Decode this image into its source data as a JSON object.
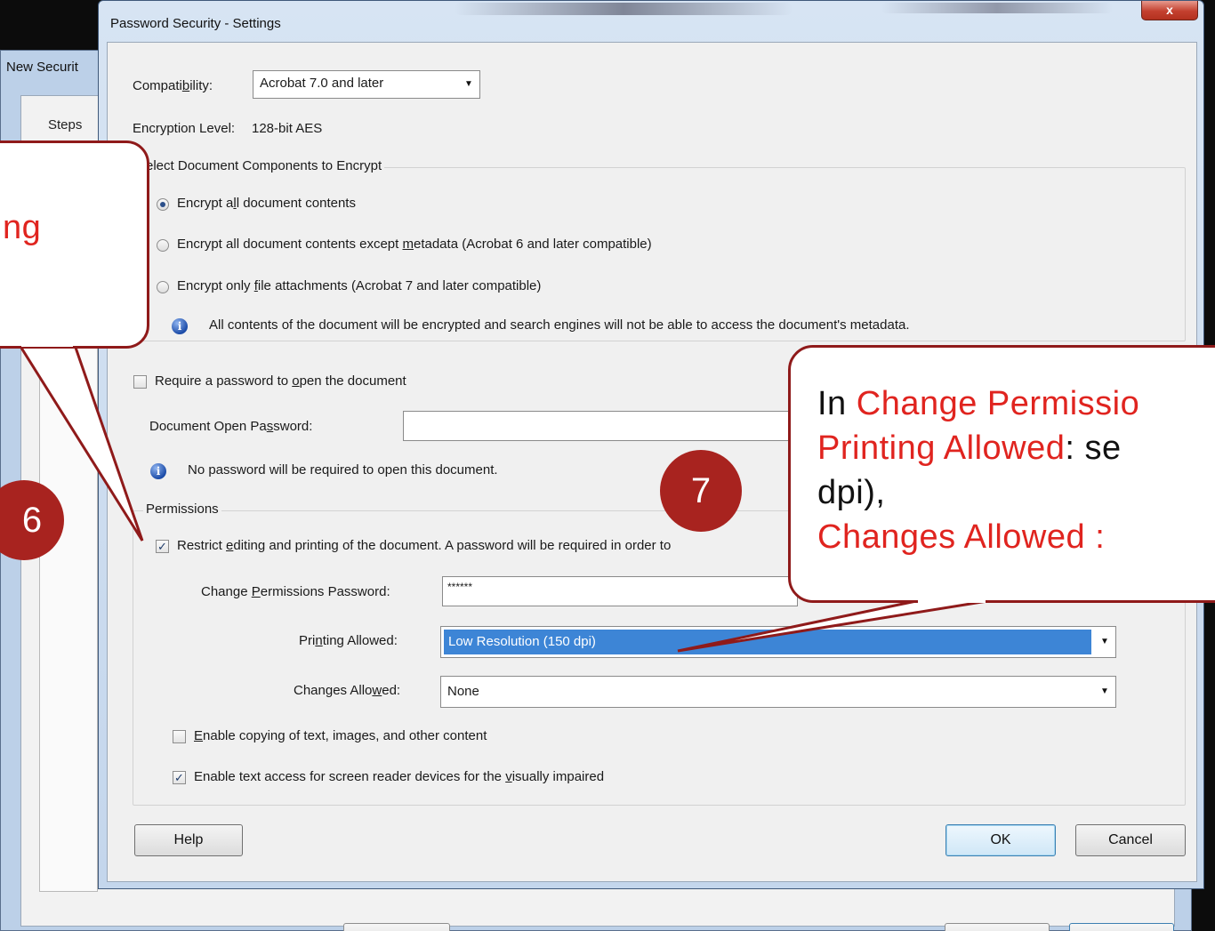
{
  "background_dialog": {
    "title": "New Securit",
    "steps_label": "Steps"
  },
  "dialog": {
    "title": "Password Security - Settings",
    "close_label": "x",
    "compatibility": {
      "label": "Compatibility:",
      "label_mnemonic": "b",
      "value": "Acrobat 7.0 and later"
    },
    "encryption_level": {
      "label": "Encryption  Level:",
      "value": "128-bit AES"
    },
    "components_group": {
      "legend": "Select Document Components to Encrypt",
      "options": [
        {
          "label": "Encrypt all document contents",
          "selected": true
        },
        {
          "label": "Encrypt all document contents except metadata (Acrobat 6 and later compatible)",
          "selected": false
        },
        {
          "label": "Encrypt only file attachments (Acrobat 7 and later compatible)",
          "selected": false
        }
      ],
      "info": "All contents of the document will be encrypted and search engines will not be able to access the document's metadata."
    },
    "open_password": {
      "checkbox_label": "Require a password to open the document",
      "checked": false,
      "field_label": "Document Open Password:",
      "value": "",
      "info": "No password will be required to open this document."
    },
    "permissions": {
      "legend": "Permissions",
      "restrict_label": "Restrict editing and printing of the document. A password will be required in order to",
      "restrict_checked": true,
      "change_password_label": "Change Permissions Password:",
      "change_password_value": "******",
      "printing_label": "Printing Allowed:",
      "printing_value": "Low Resolution (150 dpi)",
      "changes_label": "Changes Allowed:",
      "changes_value": "None",
      "copy_label": "Enable copying of text, images, and other content",
      "copy_checked": false,
      "screen_reader_label": "Enable text access for screen reader devices for the visually impaired",
      "screen_reader_checked": true
    },
    "buttons": {
      "help": "Help",
      "ok": "OK",
      "cancel": "Cancel"
    }
  },
  "callouts": {
    "left": {
      "fragment": "ng"
    },
    "right": {
      "line1_prefix": "In ",
      "line1_highlight": "Change Permissio",
      "line2_highlight": "Printing Allowed",
      "line2_suffix": ": se",
      "line3": "dpi),",
      "line4_highlight": "Changes Allowed :"
    }
  },
  "step_badges": {
    "six": "6",
    "seven": "7"
  },
  "colors": {
    "callout_border": "#8f1a1a",
    "callout_highlight": "#e0241f",
    "badge": "#a8231f",
    "selection": "#3d85d6"
  }
}
